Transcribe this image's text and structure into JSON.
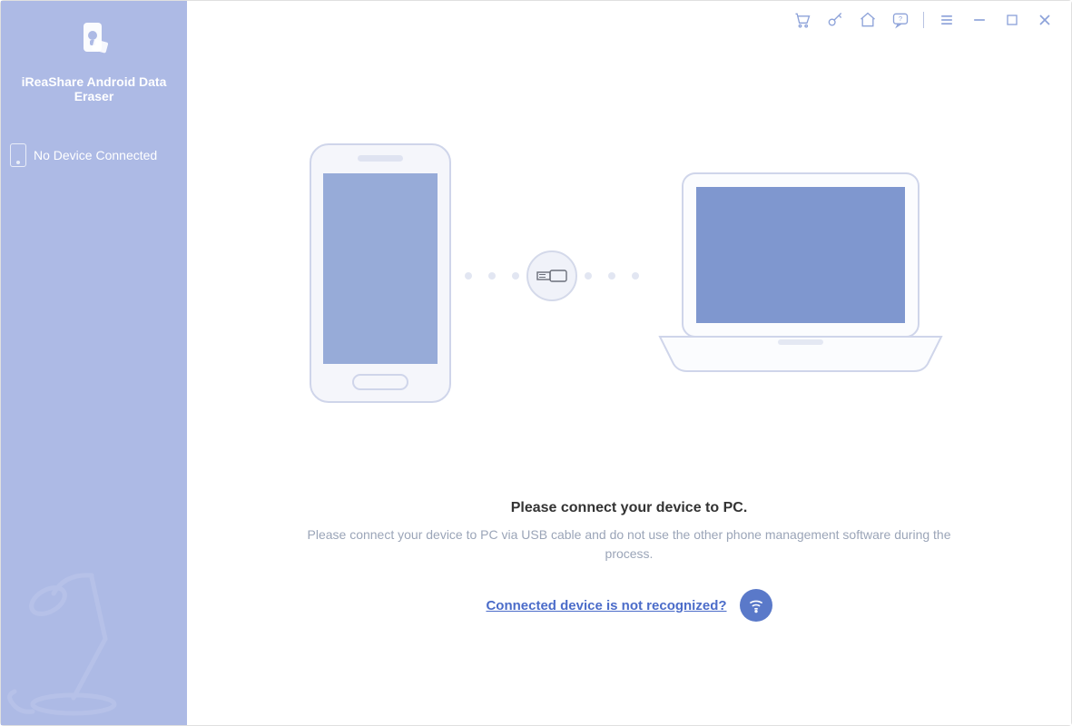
{
  "sidebar": {
    "brand_title": "iReaShare Android Data Eraser",
    "status_label": "No Device Connected"
  },
  "main": {
    "headline": "Please connect your device to PC.",
    "subline": "Please connect your device to PC via USB cable and do not use the other phone management software during the process.",
    "help_link": "Connected device is not recognized?"
  },
  "colors": {
    "sidebar_bg": "#adbae5",
    "accent": "#5a79c9",
    "illustration_fill": "#97abd8",
    "muted_text": "#9ba5b8"
  }
}
